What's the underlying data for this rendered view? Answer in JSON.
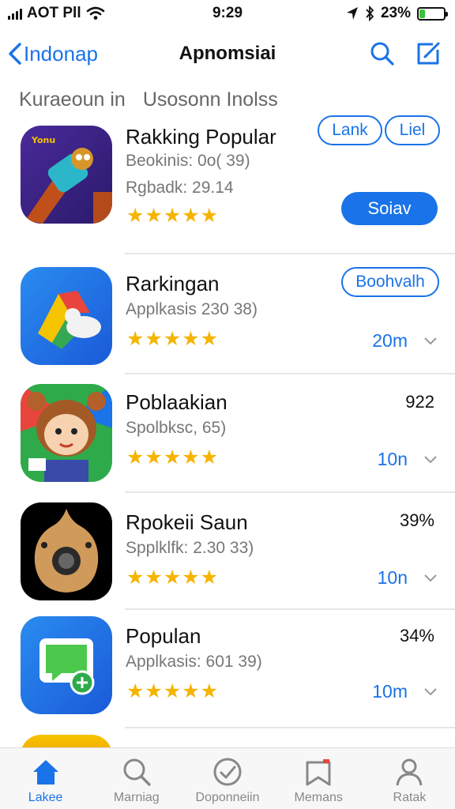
{
  "status_bar": {
    "carrier": "AOT Pll",
    "time": "9:29",
    "battery": "23%",
    "battery_level": 0.23,
    "battery_color": "#3cc23c"
  },
  "nav": {
    "back_label": "Indonap",
    "title": "Apnomsiai",
    "search_icon": "search-icon",
    "edit_icon": "compose-icon"
  },
  "section": {
    "left": "Kuraeoun in",
    "right": "Usosonn Inolss"
  },
  "accent_color": "#1a73e8",
  "star_color": "#f5b400",
  "apps": [
    {
      "name": "Rakking Popular",
      "sub": "Beokinis: 0o( 39)",
      "sub2": "Rgbadk: 29.14",
      "stars": "★★★★★",
      "pill_1": "Lank",
      "pill_2": "Liel",
      "action": "Soiav"
    },
    {
      "name": "Rarkingan",
      "sub": "Applkasis 230 38)",
      "stars": "★★★★★",
      "pill_1": "Boohvalh",
      "size": "20m"
    },
    {
      "name": "Poblaakian",
      "sub": "Spolbksc, 65)",
      "stars": "★★★★★",
      "right_num": "922",
      "size": "10n"
    },
    {
      "name": "Rpokeii Saun",
      "sub": "Spplklfk: 2.30 33)",
      "stars": "★★★★★",
      "right_num": "39%",
      "size": "10n"
    },
    {
      "name": "Populan",
      "sub": "Applkasis: 601 39)",
      "stars": "★★★★★",
      "right_num": "34%",
      "size": "10m"
    }
  ],
  "tabs": [
    {
      "label": "Lakee",
      "icon": "home-icon"
    },
    {
      "label": "Marniag",
      "icon": "search-icon"
    },
    {
      "label": "Doponneiin",
      "icon": "check-circle-icon"
    },
    {
      "label": "Memans",
      "icon": "inbox-icon"
    },
    {
      "label": "Ratak",
      "icon": "person-icon"
    }
  ]
}
